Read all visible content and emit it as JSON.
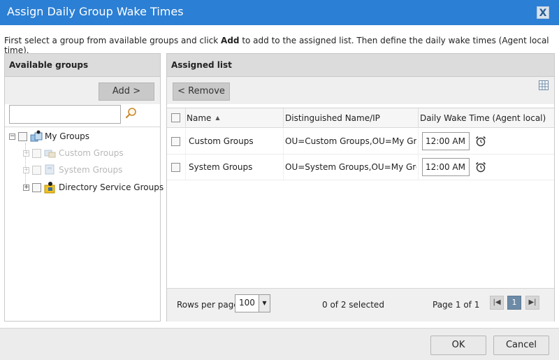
{
  "dialog": {
    "title": "Assign Daily Group Wake Times",
    "close_label": "X",
    "instructions_pre": "First select a group from available groups and click ",
    "instructions_bold": "Add",
    "instructions_post": " to add to the assigned list. Then define the daily wake times (Agent local time)."
  },
  "available": {
    "header": "Available groups",
    "add_label": "Add >",
    "search": {
      "value": "",
      "placeholder": ""
    },
    "tree": [
      {
        "label": "My Groups",
        "expander": "−",
        "enabled": true
      },
      {
        "label": "Custom Groups",
        "expander": "+",
        "enabled": false
      },
      {
        "label": "System Groups",
        "expander": "+",
        "enabled": false
      },
      {
        "label": "Directory Service Groups",
        "expander": "+",
        "enabled": true
      }
    ]
  },
  "assigned": {
    "header": "Assigned list",
    "remove_label": "< Remove",
    "columns": {
      "name": "Name",
      "dn": "Distinguished Name/IP",
      "wake": "Daily Wake Time (Agent local)"
    },
    "rows": [
      {
        "name": "Custom Groups",
        "dn": "OU=Custom Groups,OU=My Gro...",
        "wake": "12:00 AM"
      },
      {
        "name": "System Groups",
        "dn": "OU=System Groups,OU=My Grou...",
        "wake": "12:00 AM"
      }
    ],
    "footer": {
      "rows_per_page_label": "Rows per page:",
      "rows_per_page_value": "100",
      "selected_text": "0 of 2 selected",
      "page_text": "Page 1 of 1",
      "current_page": "1"
    }
  },
  "buttons": {
    "ok": "OK",
    "cancel": "Cancel"
  },
  "colors": {
    "titlebar": "#2b7fd4",
    "panel_header": "#dcdcdc",
    "pager_active": "#6d8ba6"
  }
}
